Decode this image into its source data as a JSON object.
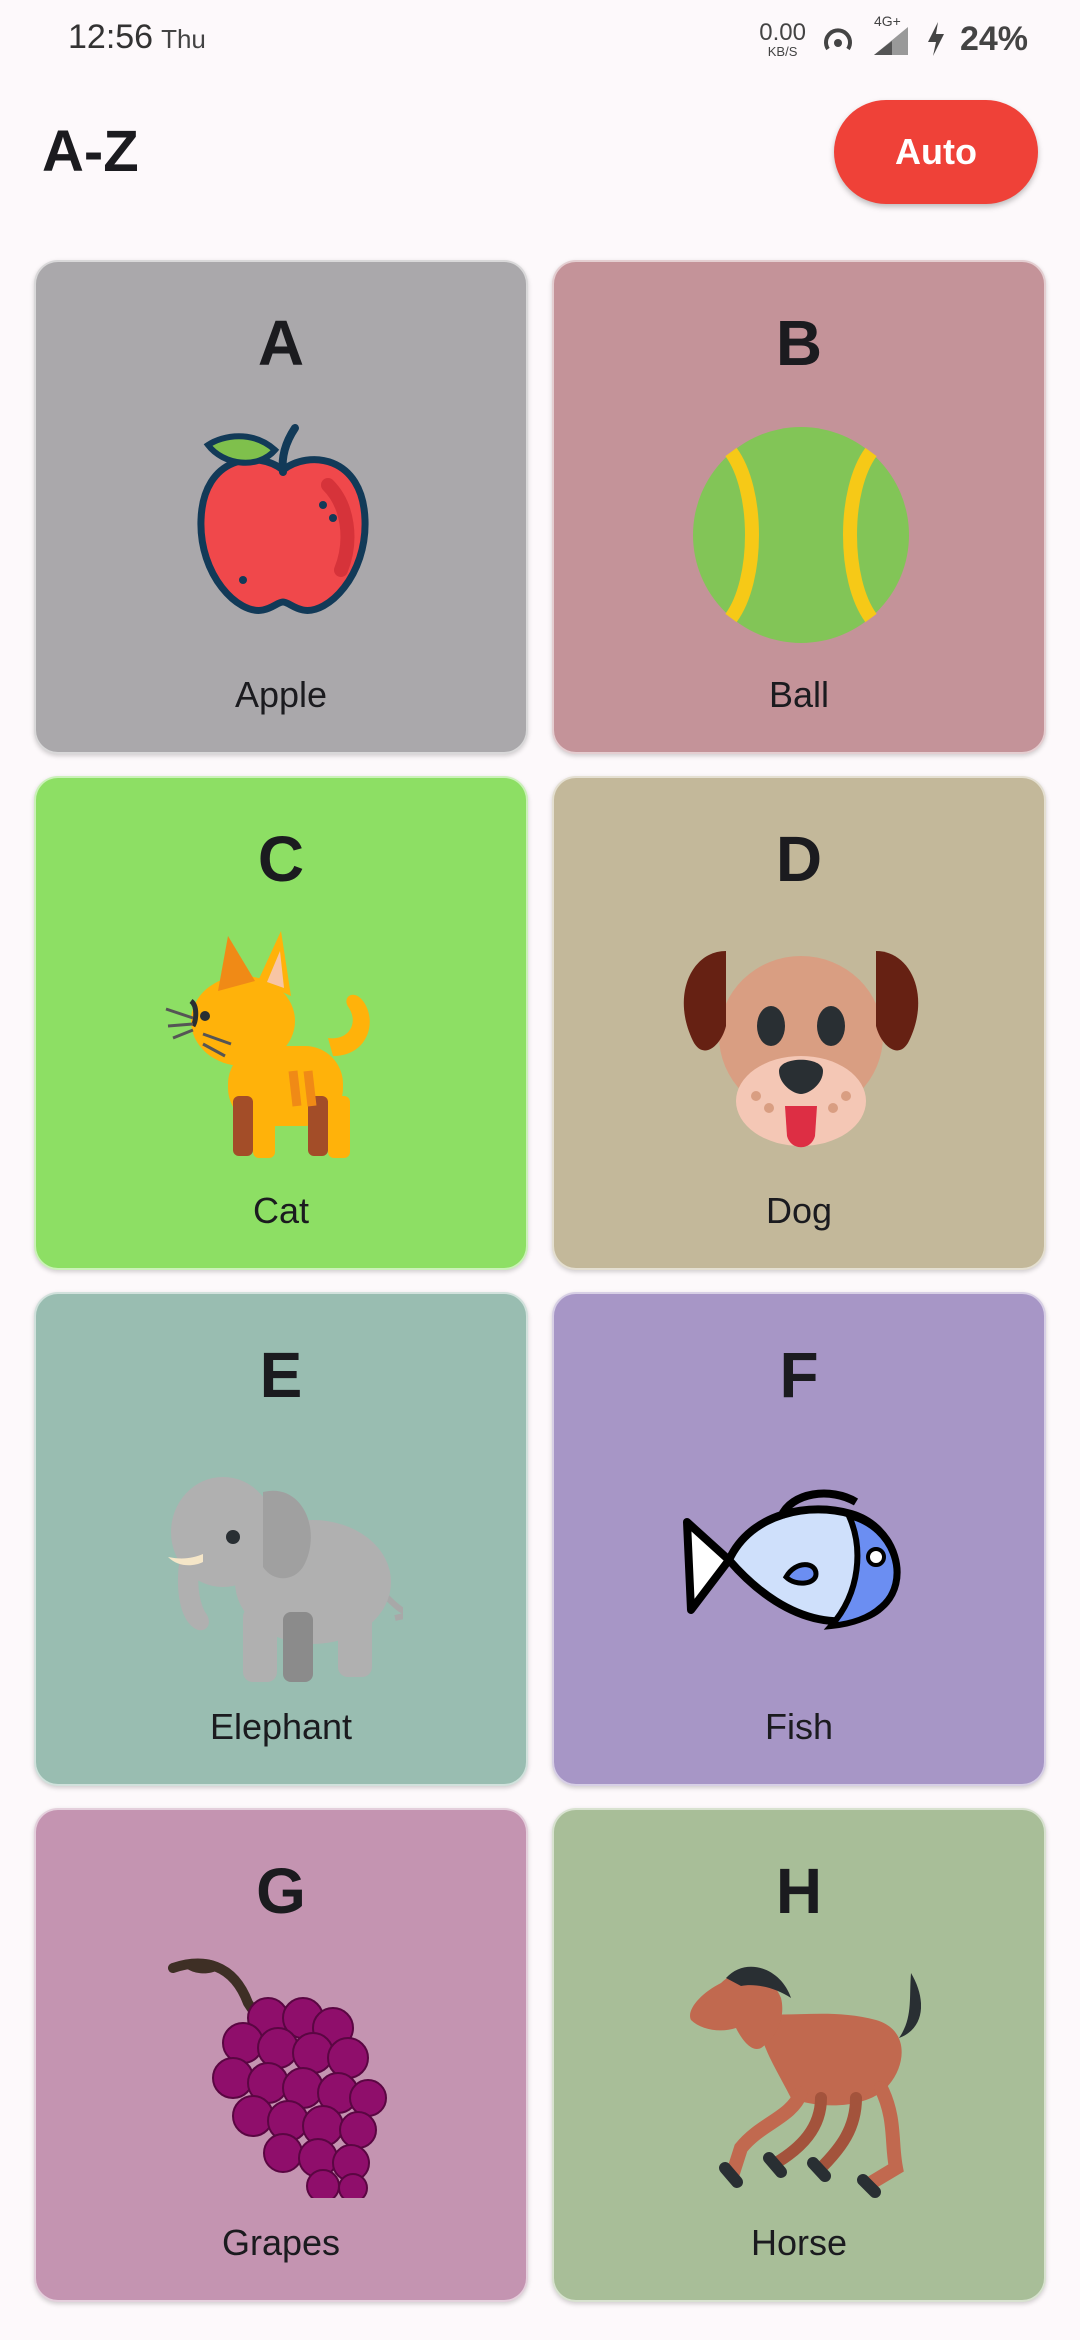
{
  "status_bar": {
    "time": "12:56",
    "day": "Thu",
    "net_speed": "0.00",
    "net_unit": "KB/S",
    "signal": "4G+",
    "battery": "24%"
  },
  "header": {
    "title": "A-Z",
    "auto_button": "Auto"
  },
  "colors": {
    "auto_button": "#ef4138",
    "card_a": "#aaa8ab",
    "card_b": "#c49399",
    "card_c": "#8ddf64",
    "card_d": "#c3b89a",
    "card_e": "#99bdb1",
    "card_f": "#a796c6",
    "card_g": "#c494b1",
    "card_h": "#a8be98"
  },
  "cards": [
    {
      "letter": "A",
      "word": "Apple",
      "icon": "apple-icon"
    },
    {
      "letter": "B",
      "word": "Ball",
      "icon": "ball-icon"
    },
    {
      "letter": "C",
      "word": "Cat",
      "icon": "cat-icon"
    },
    {
      "letter": "D",
      "word": "Dog",
      "icon": "dog-icon"
    },
    {
      "letter": "E",
      "word": "Elephant",
      "icon": "elephant-icon"
    },
    {
      "letter": "F",
      "word": "Fish",
      "icon": "fish-icon"
    },
    {
      "letter": "G",
      "word": "Grapes",
      "icon": "grapes-icon"
    },
    {
      "letter": "H",
      "word": "Horse",
      "icon": "horse-icon"
    }
  ]
}
